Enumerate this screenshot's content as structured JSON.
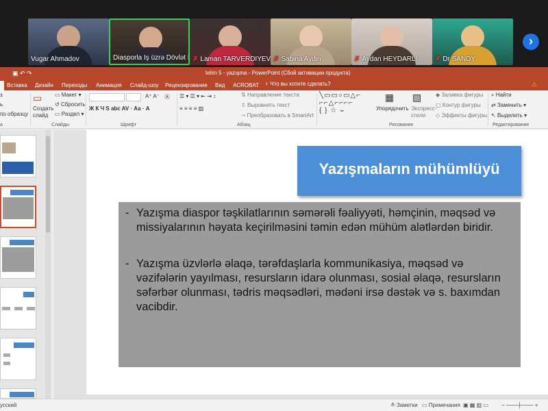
{
  "gallery": {
    "participants": [
      {
        "name": "Vugar Ahmadov",
        "muted": false
      },
      {
        "name": "Diasporla İş üzrə Dövlət K...",
        "muted": false,
        "active": true
      },
      {
        "name": "Laman TARVERDIYEVA",
        "muted": true
      },
      {
        "name": "Sabina Aydin",
        "muted": true
      },
      {
        "name": "Aydan HEYDARLI",
        "muted": true
      },
      {
        "name": "Dr SANDY",
        "muted": true
      }
    ],
    "next_icon": "›"
  },
  "ppt": {
    "window_title": "telim 5 - yazışma - PowerPoint (Сбой активации продукта)",
    "tabs": [
      "Вставка",
      "Дизайн",
      "Переходы",
      "Анимация",
      "Слайд-шоу",
      "Рецензирование",
      "Вид",
      "ACROBAT"
    ],
    "tell_me": "Что вы хотите сделать?",
    "ribbon": {
      "paste_to": "по образцу",
      "create_slide": "Создать\nслайд",
      "layout": "Макет",
      "reset": "Сбросить",
      "section": "Раздел",
      "slides_group": "Слайды",
      "font_group": "Шрифт",
      "paragraph_group": "Абзац",
      "drawing_group": "Рисование",
      "editing_group": "Редактирование",
      "text_direction": "Направление текста",
      "align_text": "Выровнять текст",
      "convert_smartart": "Преобразовать в SmartArt",
      "arrange": "Упорядочить",
      "quick_styles": "Экспресс-\nстили",
      "shape_fill": "Заливка фигуры",
      "shape_outline": "Контур фигуры",
      "shape_effects": "Эффекты фигуры",
      "find": "Найти",
      "replace": "Заменить",
      "select": "Выделить"
    },
    "slide": {
      "title": "Yazışmaların mühümlüyü",
      "bullets": [
        "Yazışma diaspor təşkilatlarının səmərəli fəaliyyəti, həmçinin, məqsəd və missiyalarının həyata keçirilməsini təmin edən mühüm alətlərdən biridir.",
        "Yazışma üzvlərlə əlaqə, tərəfdaşlarla kommunikasiya, məqsəd və vəzifələrin yayılması, resursların idarə olunması, sosial əlaqə, resursların səfərbər olunması, tədris məqsədləri, mədəni irsə dəstək və s. baxımdan vacibdir."
      ]
    },
    "status": {
      "language": "усский",
      "notes": "Заметки",
      "comments": "Примечания"
    },
    "colors": {
      "accent": "#b7472a",
      "title_box": "#4d8fd6",
      "content_box": "#9b9b9b"
    }
  }
}
